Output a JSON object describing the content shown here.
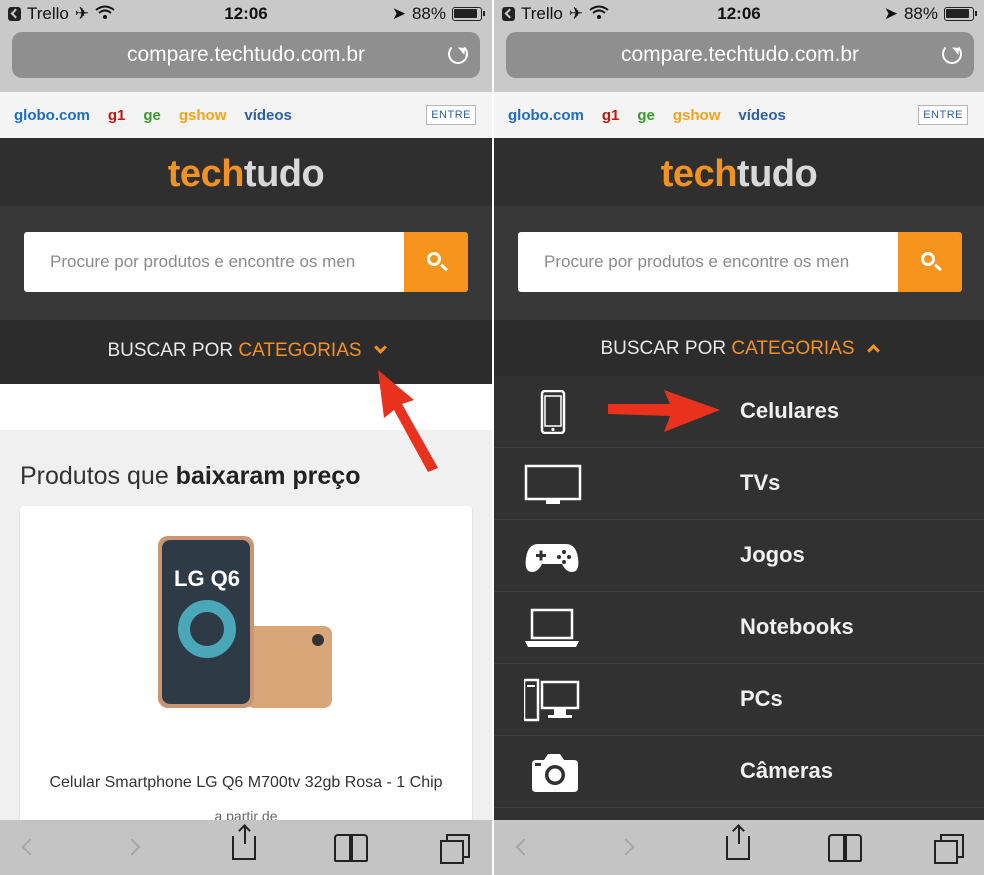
{
  "status": {
    "carrier": "Trello",
    "time": "12:06",
    "battery": "88%"
  },
  "address_bar": {
    "url": "compare.techtudo.com.br"
  },
  "globo_bar": {
    "links": [
      "globo.com",
      "g1",
      "ge",
      "gshow",
      "vídeos"
    ],
    "login_label": "ENTRE"
  },
  "header": {
    "logo_part1": "tech",
    "logo_part2": "tudo"
  },
  "search": {
    "placeholder": "Procure por produtos e encontre os men"
  },
  "categories_bar": {
    "prefix": "BUSCAR POR",
    "highlight": "CATEGORIAS"
  },
  "featured": {
    "title_part1": "Produtos que ",
    "title_bold": "baixaram preço",
    "product_image_text": "LG Q6",
    "product_name": "Celular Smartphone LG Q6 M700tv 32gb Rosa - 1 Chip",
    "price_prefix": "a partir de"
  },
  "category_menu": {
    "items": [
      {
        "label": "Celulares",
        "icon": "smartphone-icon"
      },
      {
        "label": "TVs",
        "icon": "tv-icon"
      },
      {
        "label": "Jogos",
        "icon": "gamepad-icon"
      },
      {
        "label": "Notebooks",
        "icon": "laptop-icon"
      },
      {
        "label": "PCs",
        "icon": "desktop-pc-icon"
      },
      {
        "label": "Câmeras",
        "icon": "camera-icon"
      }
    ]
  },
  "colors": {
    "accent": "#f29222",
    "dark_bg": "#2f2f2f",
    "annotation_arrow": "#e8321e"
  }
}
